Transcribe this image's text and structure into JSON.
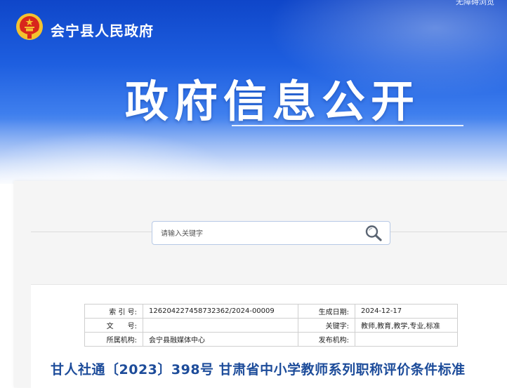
{
  "header": {
    "accessibility_link": "无障碍浏览",
    "site_name": "会宁县人民政府",
    "banner_title": "政府信息公开"
  },
  "search": {
    "placeholder": "请输入关键字"
  },
  "meta": {
    "index_label": "索 引 号:",
    "index_value": "126204227458732362/2024-00009",
    "date_label": "生成日期:",
    "date_value": "2024-12-17",
    "docno_label": "文　　号:",
    "docno_value": "",
    "keywords_label": "关键字:",
    "keywords_value": "教师,教育,教学,专业,标准",
    "org_label": "所属机构:",
    "org_value": "会宁县融媒体中心",
    "publisher_label": "发布机构:",
    "publisher_value": ""
  },
  "document": {
    "title": "甘人社通〔2023〕398号 甘肃省中小学教师系列职称评价条件标准"
  },
  "colors": {
    "banner_blue": "#1e5fe0",
    "title_blue": "#1d4c9a",
    "emblem_red": "#d8261c",
    "emblem_gold": "#f3c22f"
  }
}
